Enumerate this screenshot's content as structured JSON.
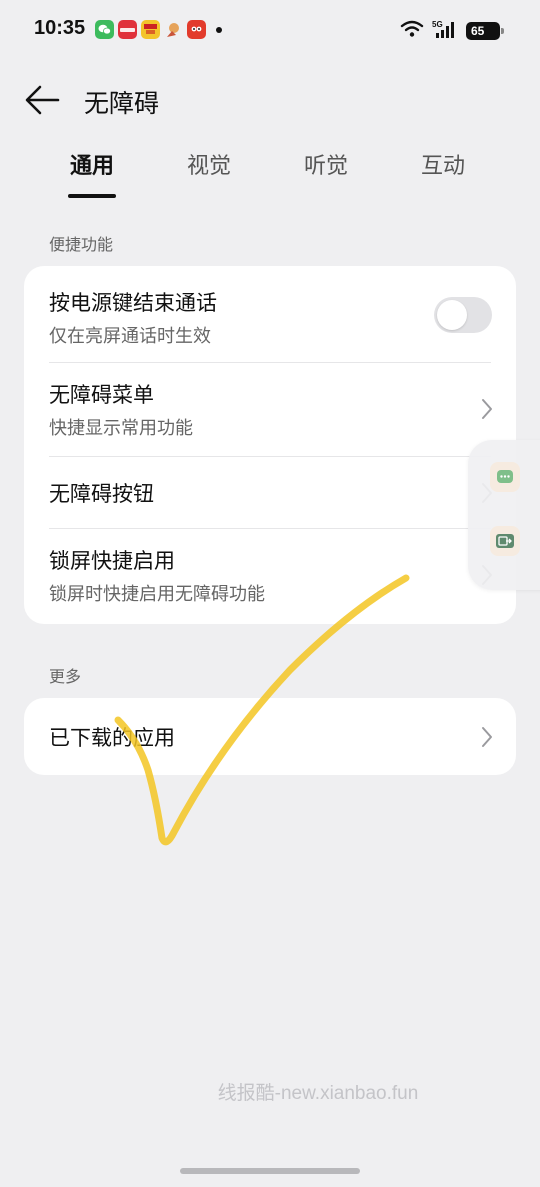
{
  "status_bar": {
    "time": "10:35",
    "battery": "65",
    "network": "5G",
    "notification_icons": [
      "wechat-icon",
      "xiaohongshu-icon",
      "app-icon",
      "app-icon",
      "app-icon"
    ]
  },
  "header": {
    "title": "无障碍"
  },
  "tabs": [
    {
      "label": "通用",
      "active": true
    },
    {
      "label": "视觉",
      "active": false
    },
    {
      "label": "听觉",
      "active": false
    },
    {
      "label": "互动",
      "active": false
    }
  ],
  "sections": {
    "shortcuts": {
      "label": "便捷功能",
      "items": [
        {
          "title": "按电源键结束通话",
          "subtitle": "仅在亮屏通话时生效",
          "control": "toggle",
          "enabled": false
        },
        {
          "title": "无障碍菜单",
          "subtitle": "快捷显示常用功能",
          "control": "chevron"
        },
        {
          "title": "无障碍按钮",
          "control": "chevron"
        },
        {
          "title": "锁屏快捷启用",
          "subtitle": "锁屏时快捷启用无障碍功能",
          "control": "chevron"
        }
      ]
    },
    "more": {
      "label": "更多",
      "items": [
        {
          "title": "已下载的应用",
          "control": "chevron"
        }
      ]
    }
  },
  "watermark": "线报酷-new.xianbao.fun",
  "colors": {
    "background": "#efeff1",
    "card": "#ffffff",
    "accent_check": "#f3c623"
  }
}
